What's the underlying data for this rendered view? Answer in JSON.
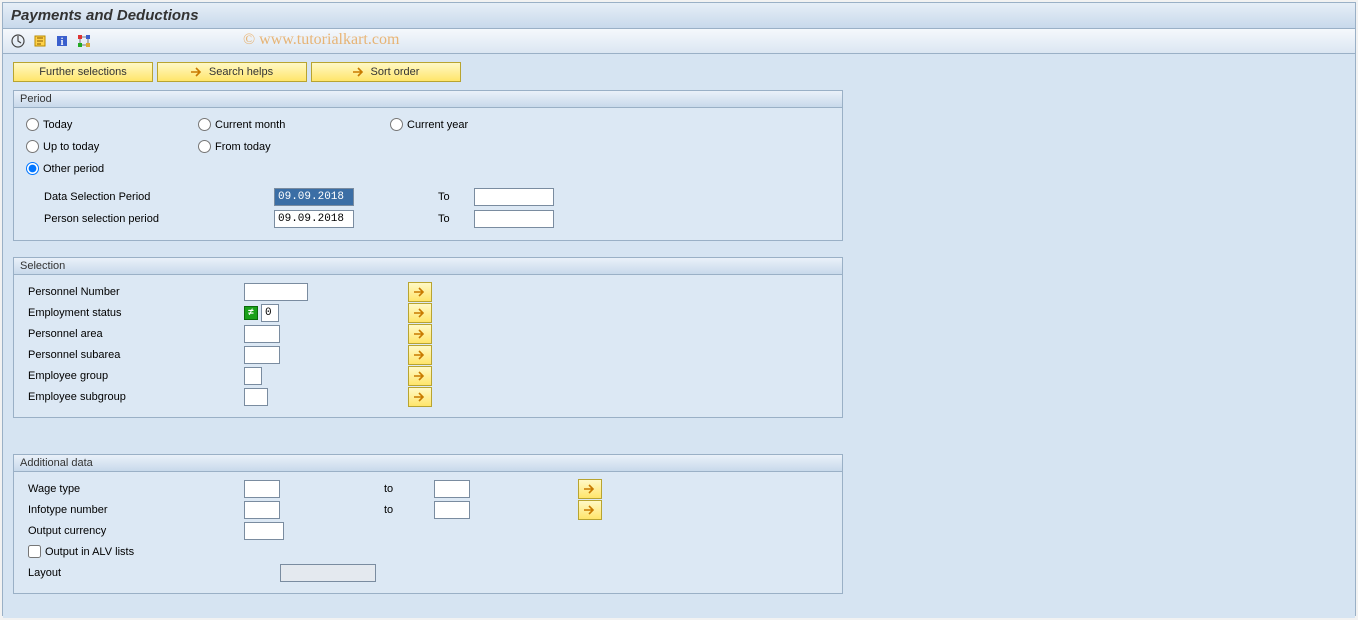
{
  "title": "Payments and Deductions",
  "watermark": "© www.tutorialkart.com",
  "toolbar": {
    "further_selections": "Further selections",
    "search_helps": "Search helps",
    "sort_order": "Sort order"
  },
  "period": {
    "legend": "Period",
    "today": "Today",
    "current_month": "Current month",
    "current_year": "Current year",
    "up_to_today": "Up to today",
    "from_today": "From today",
    "other_period": "Other period",
    "data_selection_label": "Data Selection Period",
    "data_selection_from": "09.09.2018",
    "data_selection_to_label": "To",
    "data_selection_to": "",
    "person_selection_label": "Person selection period",
    "person_selection_from": "09.09.2018",
    "person_selection_to_label": "To",
    "person_selection_to": ""
  },
  "selection": {
    "legend": "Selection",
    "personnel_number": {
      "label": "Personnel Number",
      "value": ""
    },
    "employment_status": {
      "label": "Employment status",
      "value": "0",
      "ne_indicator": "≠"
    },
    "personnel_area": {
      "label": "Personnel area",
      "value": ""
    },
    "personnel_subarea": {
      "label": "Personnel subarea",
      "value": ""
    },
    "employee_group": {
      "label": "Employee group",
      "value": ""
    },
    "employee_subgroup": {
      "label": "Employee subgroup",
      "value": ""
    }
  },
  "additional": {
    "legend": "Additional data",
    "wage_type": {
      "label": "Wage type",
      "from": "",
      "to_label": "to",
      "to": ""
    },
    "infotype_number": {
      "label": "Infotype number",
      "from": "",
      "to_label": "to",
      "to": ""
    },
    "output_currency": {
      "label": "Output currency",
      "value": ""
    },
    "alv_label": "Output in ALV lists",
    "alv_checked": false,
    "layout": {
      "label": "Layout",
      "value": ""
    }
  }
}
